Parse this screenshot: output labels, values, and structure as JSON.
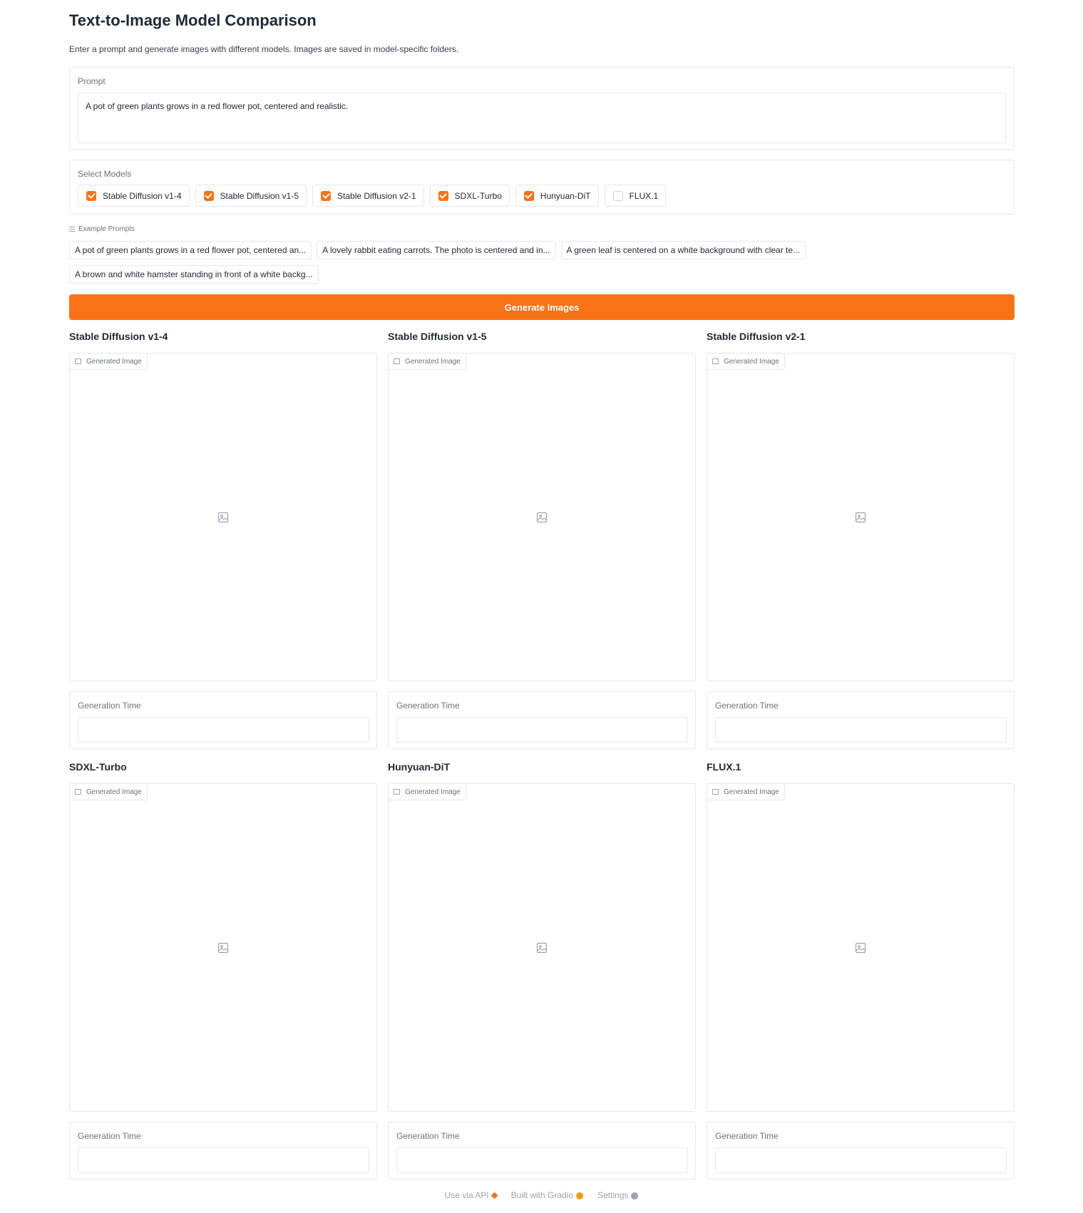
{
  "app": {
    "title": "Text-to-Image Model Comparison",
    "subtitle": "Enter a prompt and generate images with different models. Images are saved in model-specific folders."
  },
  "prompt": {
    "label": "Prompt",
    "value": "A pot of green plants grows in a red flower pot, centered and realistic."
  },
  "models": {
    "label": "Select Models",
    "options": [
      {
        "label": "Stable Diffusion v1-4",
        "checked": true
      },
      {
        "label": "Stable Diffusion v1-5",
        "checked": true
      },
      {
        "label": "Stable Diffusion v2-1",
        "checked": true
      },
      {
        "label": "SDXL-Turbo",
        "checked": true
      },
      {
        "label": "Hunyuan-DiT",
        "checked": true
      },
      {
        "label": "FLUX.1",
        "checked": false
      }
    ]
  },
  "examples": {
    "label": "Example Prompts",
    "items": [
      "A pot of green plants grows in a red flower pot, centered an...",
      "A lovely rabbit eating carrots. The photo is centered and in...",
      "A green leaf is centered on a white background with clear te...",
      "A brown and white hamster standing in front of a white backg..."
    ]
  },
  "generate_button": "Generate Images",
  "outputs": [
    {
      "title": "Stable Diffusion v1-4",
      "image_label": "Generated Image",
      "time_label": "Generation Time",
      "time_value": ""
    },
    {
      "title": "Stable Diffusion v1-5",
      "image_label": "Generated Image",
      "time_label": "Generation Time",
      "time_value": ""
    },
    {
      "title": "Stable Diffusion v2-1",
      "image_label": "Generated Image",
      "time_label": "Generation Time",
      "time_value": ""
    },
    {
      "title": "SDXL-Turbo",
      "image_label": "Generated Image",
      "time_label": "Generation Time",
      "time_value": ""
    },
    {
      "title": "Hunyuan-DiT",
      "image_label": "Generated Image",
      "time_label": "Generation Time",
      "time_value": ""
    },
    {
      "title": "FLUX.1",
      "image_label": "Generated Image",
      "time_label": "Generation Time",
      "time_value": ""
    }
  ],
  "footer": {
    "api": "Use via API",
    "built": "Built with Gradio",
    "settings": "Settings",
    "separator": "·"
  },
  "colors": {
    "accent": "#f97316",
    "border": "#e5e7eb"
  }
}
